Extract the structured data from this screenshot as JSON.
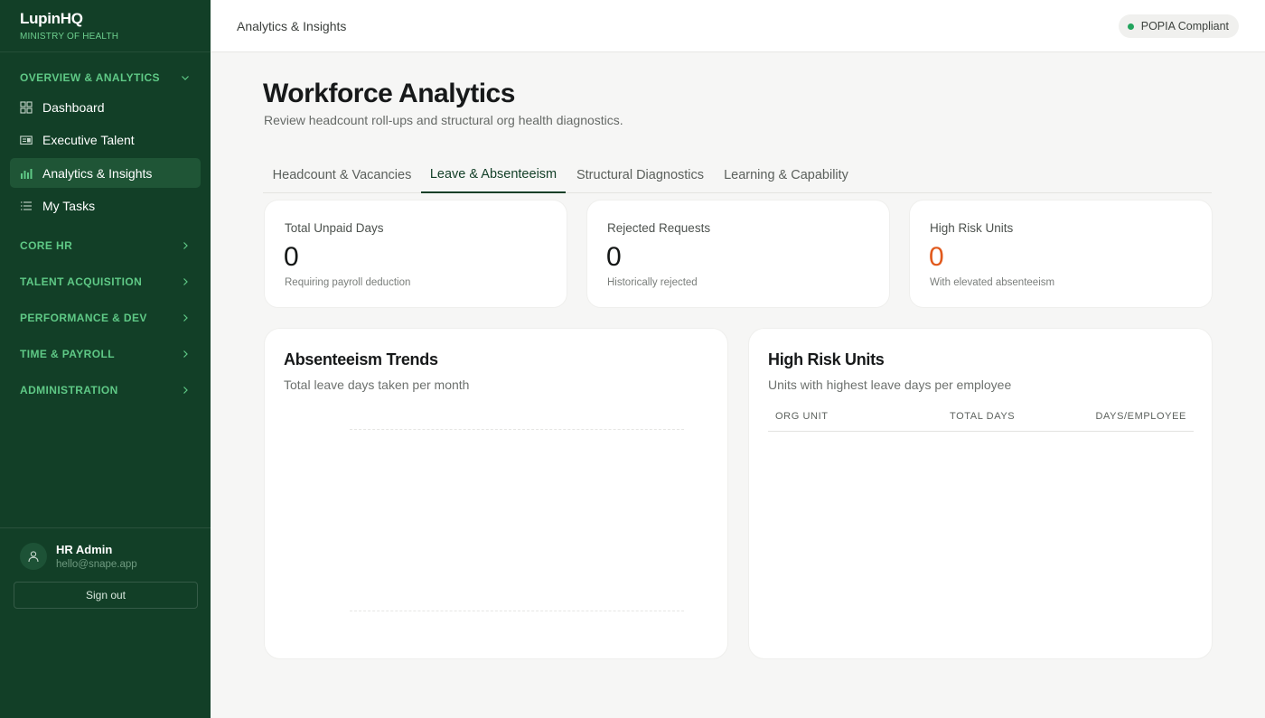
{
  "brand": {
    "name": "LupinHQ",
    "subtitle": "MINISTRY OF HEALTH"
  },
  "sidebar": {
    "overview_section": "OVERVIEW & ANALYTICS",
    "items": [
      {
        "label": "Dashboard",
        "icon": "grid-icon"
      },
      {
        "label": "Executive Talent",
        "icon": "id-card-icon"
      },
      {
        "label": "Analytics & Insights",
        "icon": "bar-chart-icon",
        "active": true
      },
      {
        "label": "My Tasks",
        "icon": "list-icon"
      }
    ],
    "sections": [
      {
        "label": "CORE HR"
      },
      {
        "label": "TALENT ACQUISITION"
      },
      {
        "label": "PERFORMANCE & DEV"
      },
      {
        "label": "TIME & PAYROLL"
      },
      {
        "label": "ADMINISTRATION"
      }
    ]
  },
  "user": {
    "name": "HR Admin",
    "email": "hello@snape.app",
    "signout_label": "Sign out"
  },
  "topbar": {
    "title": "Analytics & Insights",
    "badge_label": "POPIA Compliant",
    "badge_color": "#22a45d"
  },
  "page": {
    "title": "Workforce Analytics",
    "subtitle": "Review headcount roll-ups and structural org health diagnostics."
  },
  "tabs": [
    {
      "label": "Headcount & Vacancies"
    },
    {
      "label": "Leave & Absenteeism",
      "active": true
    },
    {
      "label": "Structural Diagnostics"
    },
    {
      "label": "Learning & Capability"
    }
  ],
  "stats": [
    {
      "label": "Total Unpaid Days",
      "value": "0",
      "note": "Requiring payroll deduction"
    },
    {
      "label": "Rejected Requests",
      "value": "0",
      "note": "Historically rejected"
    },
    {
      "label": "High Risk Units",
      "value": "0",
      "note": "With elevated absenteeism",
      "color": "#e15a1d"
    }
  ],
  "trends_panel": {
    "title": "Absenteeism Trends",
    "subtitle": "Total leave days taken per month"
  },
  "risk_panel": {
    "title": "High Risk Units",
    "subtitle": "Units with highest leave days per employee",
    "columns": [
      "ORG UNIT",
      "TOTAL DAYS",
      "DAYS/EMPLOYEE"
    ],
    "rows": []
  },
  "chart_data": {
    "type": "line",
    "title": "Absenteeism Trends",
    "subtitle": "Total leave days taken per month",
    "x": [],
    "series": [],
    "grid": true
  }
}
